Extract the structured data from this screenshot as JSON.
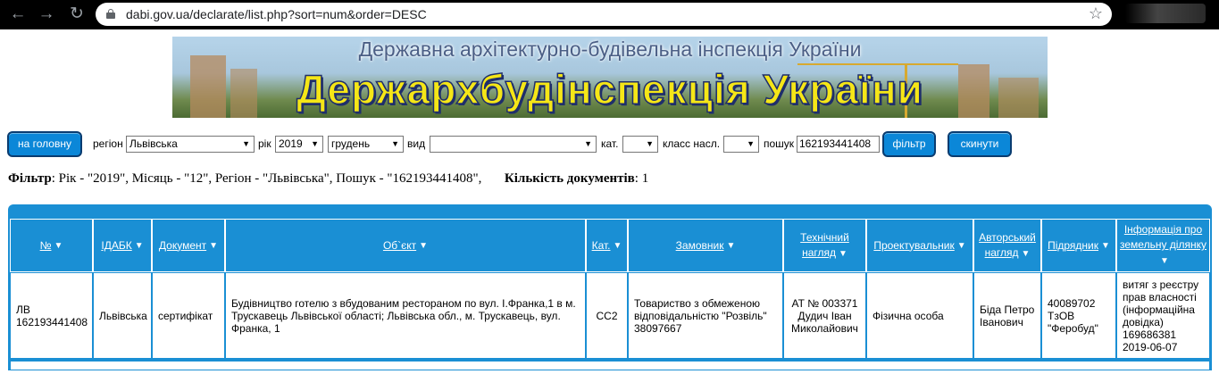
{
  "browser": {
    "url": "dabi.gov.ua/declarate/list.php?sort=num&order=DESC"
  },
  "banner": {
    "subtitle": "Державна архітектурно-будівельна інспекція України",
    "title": "Держархбудінспекція України"
  },
  "filters": {
    "home_button": "на головну",
    "region_label": "регіон",
    "region_value": "Львівська",
    "year_label": "рік",
    "year_value": "2019",
    "month_value": "грудень",
    "type_label": "вид",
    "type_value": "",
    "cat_label": "кат.",
    "cat_value": "",
    "class_label": "класс насл.",
    "class_value": "",
    "search_label": "пошук",
    "search_value": "162193441408",
    "filter_button": "фільтр",
    "reset_button": "скинути"
  },
  "summary": {
    "filter_label": "Фільтр",
    "filter_text": ": Рік - \"2019\", Місяць - \"12\", Регіон - \"Львівська\", Пошук - \"162193441408\",",
    "count_label": "Кількість документів",
    "count_value": ": 1"
  },
  "table": {
    "headers": [
      "№",
      "ІДАБК",
      "Документ",
      "Об`єкт",
      "Кат.",
      "Замовник",
      "Технічний нагляд",
      "Проектувальник",
      "Авторський нагляд",
      "Підрядник",
      "Інформація про земельну ділянку"
    ],
    "rows": [
      [
        "ЛВ\n162193441408",
        "Львівська",
        "сертифікат",
        "Будівництво готелю з вбудованим рестораном по вул. І.Франка,1 в м. Трускавець Львівської області; Львівська обл., м. Трускавець, вул. Франка, 1",
        "СС2",
        "Товариство з обмеженою відповідальністю \"Розвіль\" 38097667",
        "АТ № 003371 Дудич Іван Миколайович",
        "Фізична особа",
        "Біда Петро Іванович",
        "40089702 ТзОВ \"Феробуд\"",
        "витяг з реєстру прав власності (інформаційна довідка) 169686381 2019-06-07"
      ]
    ]
  },
  "colors": {
    "accent": "#1a8fd4",
    "button": "#0b87d8",
    "banner_title": "#f5e617"
  }
}
